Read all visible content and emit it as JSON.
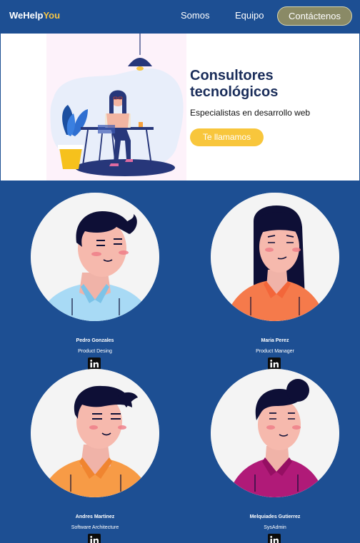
{
  "header": {
    "brand_main": "WeHelp",
    "brand_accent": "You",
    "nav": [
      "Somos",
      "Equipo"
    ],
    "contact_label": "Contáctenos"
  },
  "hero": {
    "title": "Consultores tecnológicos",
    "subtitle": "Especialistas en desarrollo web",
    "cta_label": "Te llamamos"
  },
  "team": [
    {
      "name": "Pedro Gonzales",
      "role": "Product Desing"
    },
    {
      "name": "Maria Perez",
      "role": "Product Manager"
    },
    {
      "name": "Andres Martinez",
      "role": "Software Architecture"
    },
    {
      "name": "Melquiades Gutierrez",
      "role": "SysAdmin"
    }
  ],
  "colors": {
    "primary": "#1d4f93",
    "accent": "#f6c544",
    "cta": "#f8c63c",
    "contact_button": "#8a8a66"
  },
  "icons": [
    "linkedin-icon"
  ]
}
